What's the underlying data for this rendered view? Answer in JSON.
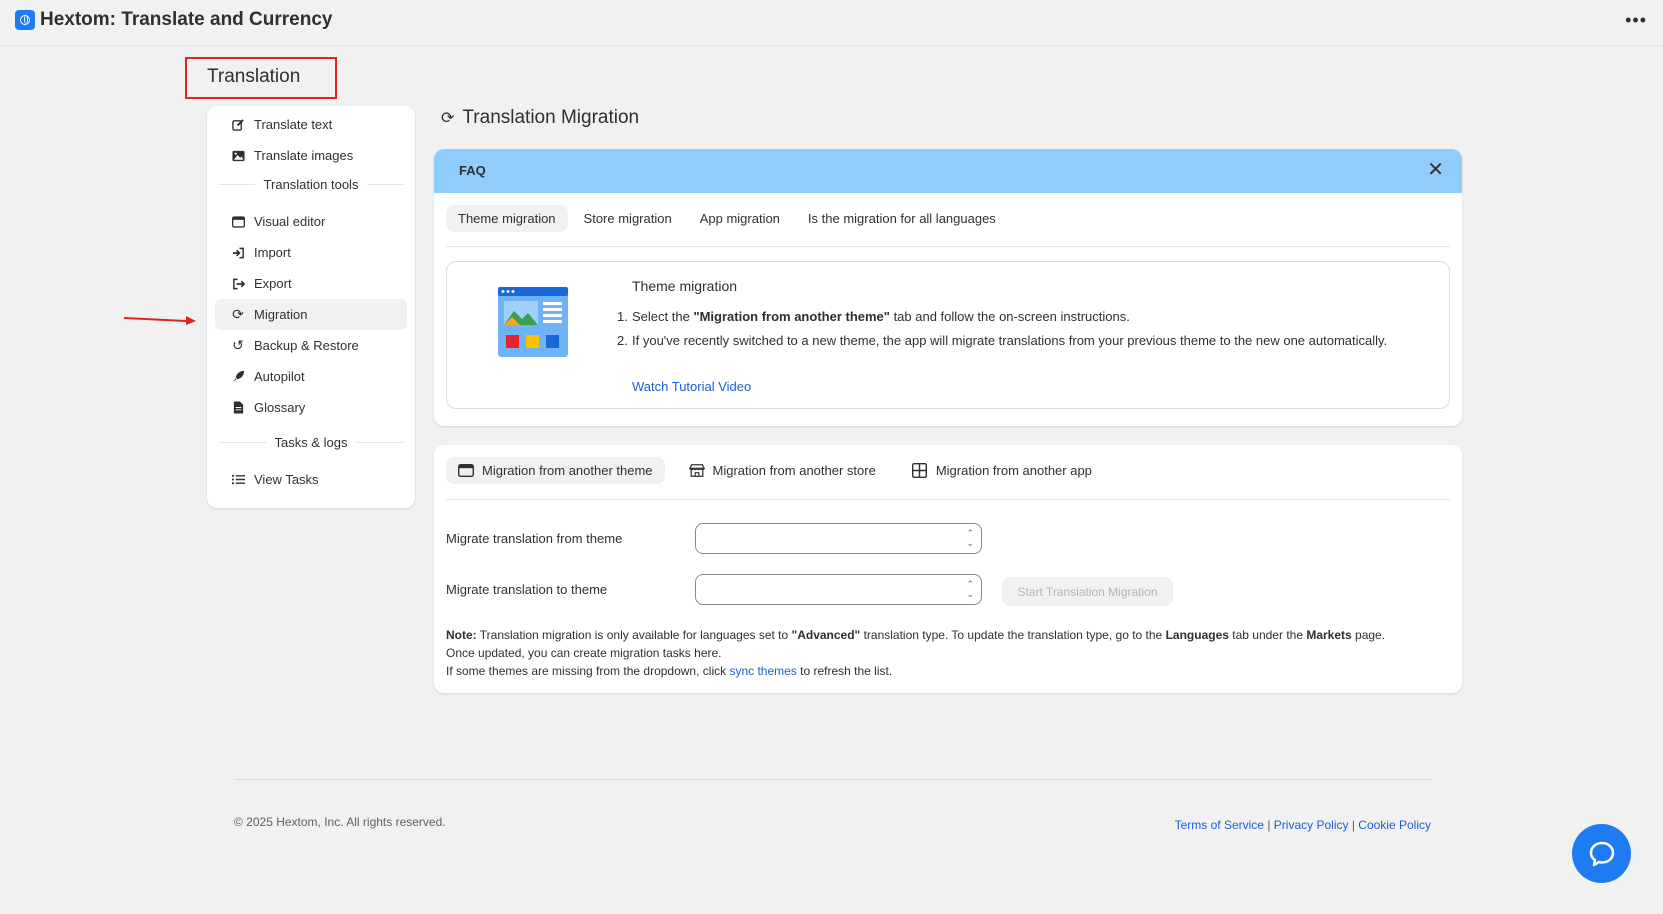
{
  "app": {
    "title": "Hextom: Translate and Currency",
    "menu_icon": "ellipsis-icon"
  },
  "page": {
    "heading": "Translation"
  },
  "sidebar": {
    "items": [
      {
        "label": "Translate text",
        "icon": "edit-icon"
      },
      {
        "label": "Translate images",
        "icon": "image-icon"
      },
      {
        "label": "Visual editor",
        "icon": "window-icon"
      },
      {
        "label": "Import",
        "icon": "import-icon"
      },
      {
        "label": "Export",
        "icon": "export-icon"
      },
      {
        "label": "Migration",
        "icon": "sync-icon",
        "active": true
      },
      {
        "label": "Backup & Restore",
        "icon": "history-icon"
      },
      {
        "label": "Autopilot",
        "icon": "rocket-icon"
      },
      {
        "label": "Glossary",
        "icon": "document-icon"
      },
      {
        "label": "View Tasks",
        "icon": "list-icon"
      }
    ],
    "sections": [
      "Translation tools",
      "Tasks & logs"
    ]
  },
  "main": {
    "title": "Translation Migration",
    "faq": {
      "label": "FAQ",
      "tabs": [
        "Theme migration",
        "Store migration",
        "App migration",
        "Is the migration for all languages"
      ],
      "active_tab": "Theme migration",
      "content_title": "Theme migration",
      "steps": [
        {
          "num": "1.",
          "pre": "Select the ",
          "bold": "\"Migration from another theme\"",
          "post": " tab and follow the on-screen instructions."
        },
        {
          "num": "2.",
          "pre": "If you've recently switched to a new theme, the app will migrate translations from your previous theme to the new one automatically.",
          "bold": "",
          "post": ""
        }
      ],
      "link": "Watch Tutorial Video"
    },
    "migration": {
      "tabs": [
        {
          "label": "Migration from another theme",
          "icon": "theme-icon",
          "active": true
        },
        {
          "label": "Migration from another store",
          "icon": "store-icon"
        },
        {
          "label": "Migration from another app",
          "icon": "apps-icon"
        }
      ],
      "from_label": "Migrate translation from theme",
      "to_label": "Migrate translation to theme",
      "from_value": "",
      "to_value": "",
      "start_button": "Start Translation Migration",
      "note": {
        "prefix": "Note:",
        "t1": " Translation migration is only available for languages set to ",
        "b1": "\"Advanced\"",
        "t2": " translation type. To update the translation type, go to the ",
        "b2": "Languages",
        "t3": " tab under the ",
        "b3": "Markets",
        "t4": " page.",
        "line2": "Once updated, you can create migration tasks here.",
        "line3_pre": "If some themes are missing from the dropdown, click ",
        "line3_link": "sync themes",
        "line3_post": " to refresh the list."
      }
    }
  },
  "footer": {
    "copyright": "© 2025 Hextom, Inc. All rights reserved.",
    "links": [
      "Terms of Service",
      "Privacy Policy",
      "Cookie Policy"
    ],
    "separator": "|"
  },
  "colors": {
    "accent": "#1f7bf2",
    "faq_header": "#91cdfc",
    "highlight": "#e02424",
    "link": "#1b5fd6"
  }
}
